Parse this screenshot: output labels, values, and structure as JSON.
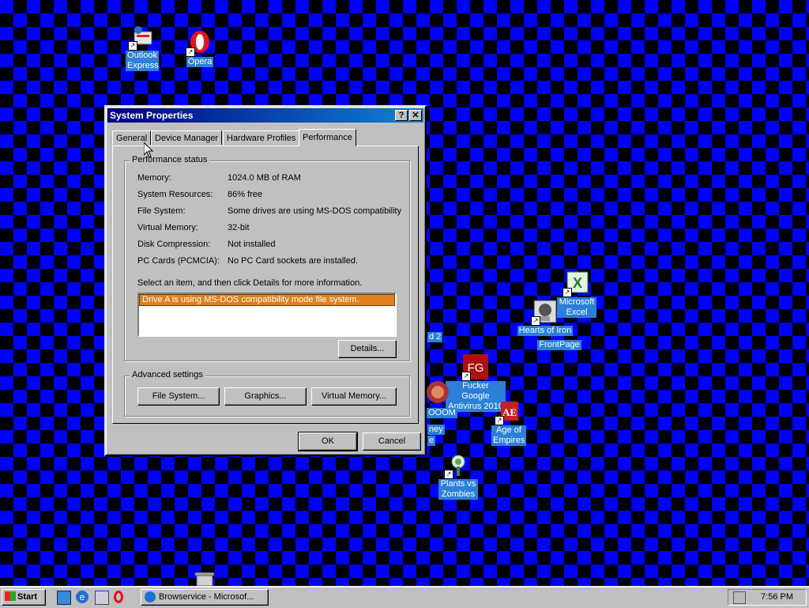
{
  "desktop": {
    "icons": [
      {
        "label": "Outlook Express",
        "icon": "outlook-express-icon"
      },
      {
        "label": "Opera",
        "icon": "opera-icon"
      },
      {
        "label": "Microsoft Excel",
        "icon": "excel-icon"
      },
      {
        "label": "Hearts of Iron",
        "icon": "hearts-of-iron-icon"
      },
      {
        "label": "FrontPage",
        "icon": "frontpage-icon"
      },
      {
        "label": "Fucker Google Antivirus 2010",
        "icon": "antivirus-icon"
      },
      {
        "label": "Age of Empires",
        "icon": "age-of-empires-icon"
      },
      {
        "label": "Plants vs Zombies",
        "icon": "plants-vs-zombies-icon"
      },
      {
        "label": "OOOM",
        "icon": "doom-icon"
      }
    ],
    "partial_labels": [
      "d 2",
      "ney",
      "e"
    ]
  },
  "window": {
    "title": "System Properties",
    "help_btn": "?",
    "close_btn": "✕",
    "tabs": [
      "General",
      "Device Manager",
      "Hardware Profiles",
      "Performance"
    ],
    "active_tab": "Performance",
    "status_group": "Performance status",
    "status": [
      {
        "key": "Memory:",
        "value": "1024.0 MB of RAM"
      },
      {
        "key": "System Resources:",
        "value": "86% free"
      },
      {
        "key": "File System:",
        "value": "Some drives are using MS-DOS compatibility"
      },
      {
        "key": "Virtual Memory:",
        "value": "32-bit"
      },
      {
        "key": "Disk Compression:",
        "value": "Not installed"
      },
      {
        "key": "PC Cards (PCMCIA):",
        "value": "No PC Card sockets are installed."
      }
    ],
    "instruction": "Select an item, and then click Details for more information.",
    "list_items": [
      "Drive A is using MS-DOS compatibility mode file system."
    ],
    "details_btn": "Details...",
    "advanced_group": "Advanced settings",
    "file_system_btn": "File System...",
    "graphics_btn": "Graphics...",
    "virtual_memory_btn": "Virtual Memory...",
    "ok_btn": "OK",
    "cancel_btn": "Cancel"
  },
  "taskbar": {
    "start": "Start",
    "quick_launch": [
      "show-desktop-icon",
      "ie-icon",
      "outlook-icon",
      "opera-icon"
    ],
    "task": "Browservice - Microsof...",
    "clock": "7:56 PM"
  }
}
